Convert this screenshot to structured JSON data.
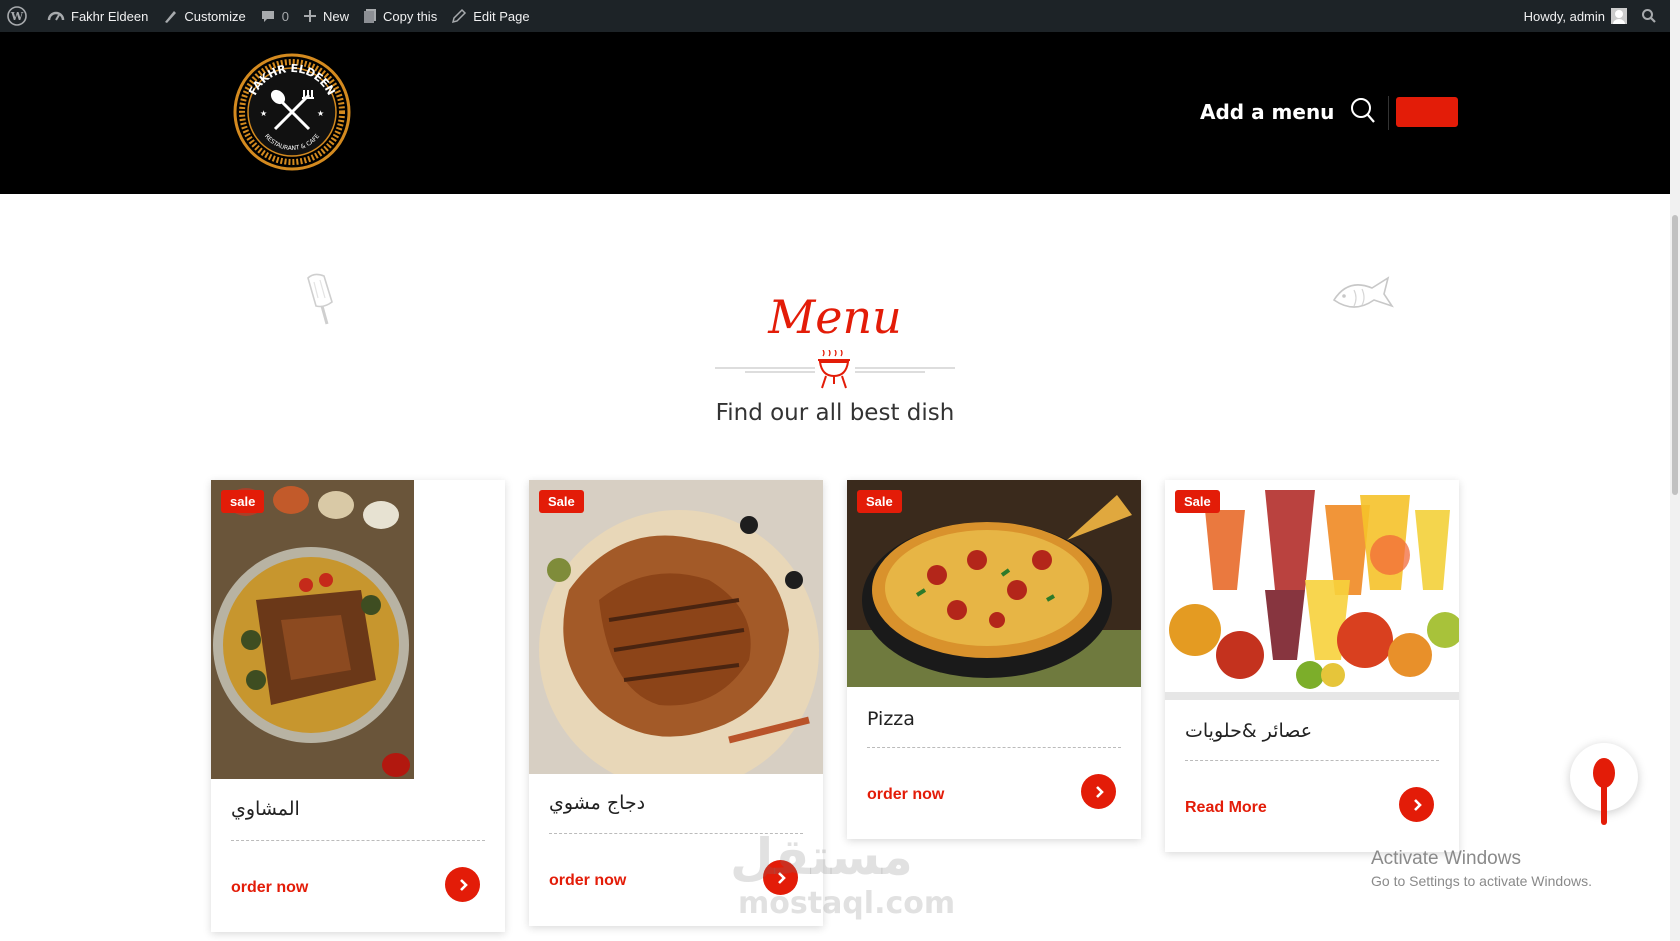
{
  "admin_bar": {
    "site_name": "Fakhr Eldeen",
    "customize": "Customize",
    "comments_count": "0",
    "new": "New",
    "copy": "Copy this",
    "edit": "Edit Page",
    "howdy": "Howdy, admin"
  },
  "header": {
    "logo_text": "FAKHR ELDEEN",
    "logo_subtext": "RESTAURANT & CAFE",
    "nav_item": "Add a menu"
  },
  "section": {
    "title": "Menu",
    "subtitle": "Find our all best dish"
  },
  "cards": [
    {
      "badge": "sale",
      "title": "المشاوي",
      "link": "order now",
      "image_icon": "grill-platter-photo"
    },
    {
      "badge": "Sale",
      "title": "دجاج مشوي",
      "link": "order now",
      "image_icon": "grilled-chicken-photo"
    },
    {
      "badge": "Sale",
      "title": "Pizza",
      "link": "order now",
      "image_icon": "pizza-photo"
    },
    {
      "badge": "Sale",
      "title": "عصائر &حلويات",
      "link": "Read More",
      "image_icon": "juices-fruits-photo"
    }
  ],
  "watermark": {
    "arabic": "مستقل",
    "latin": "mostaql.com"
  },
  "activate_windows": {
    "title": "Activate Windows",
    "subtitle": "Go to Settings to activate Windows."
  },
  "colors": {
    "accent": "#e31c08",
    "admin_bar": "#1d2327",
    "header": "#000000"
  }
}
